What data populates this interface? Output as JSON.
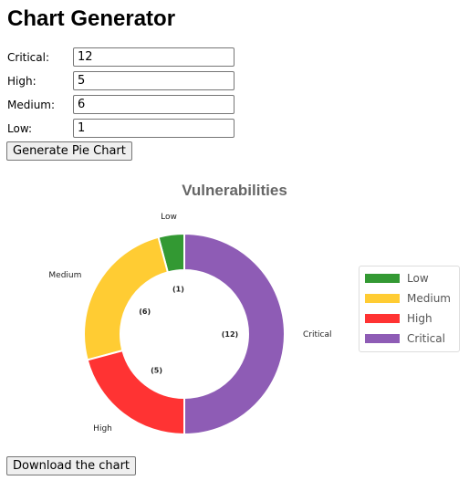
{
  "page": {
    "title": "Chart Generator"
  },
  "form": {
    "fields": [
      {
        "label": "Critical:",
        "value": "12"
      },
      {
        "label": "High:",
        "value": "5"
      },
      {
        "label": "Medium:",
        "value": "6"
      },
      {
        "label": "Low:",
        "value": "1"
      }
    ],
    "generate_label": "Generate Pie Chart",
    "download_label": "Download the chart"
  },
  "chart_data": {
    "type": "pie",
    "title": "Vulnerabilities",
    "categories": [
      "Low",
      "Medium",
      "High",
      "Critical"
    ],
    "values": [
      1,
      6,
      5,
      12
    ],
    "data_labels": [
      "(1)",
      "(6)",
      "(5)",
      "(12)"
    ],
    "colors": [
      "#339933",
      "#ffcc33",
      "#ff3333",
      "#8e5cb5"
    ],
    "legend_position": "right"
  }
}
